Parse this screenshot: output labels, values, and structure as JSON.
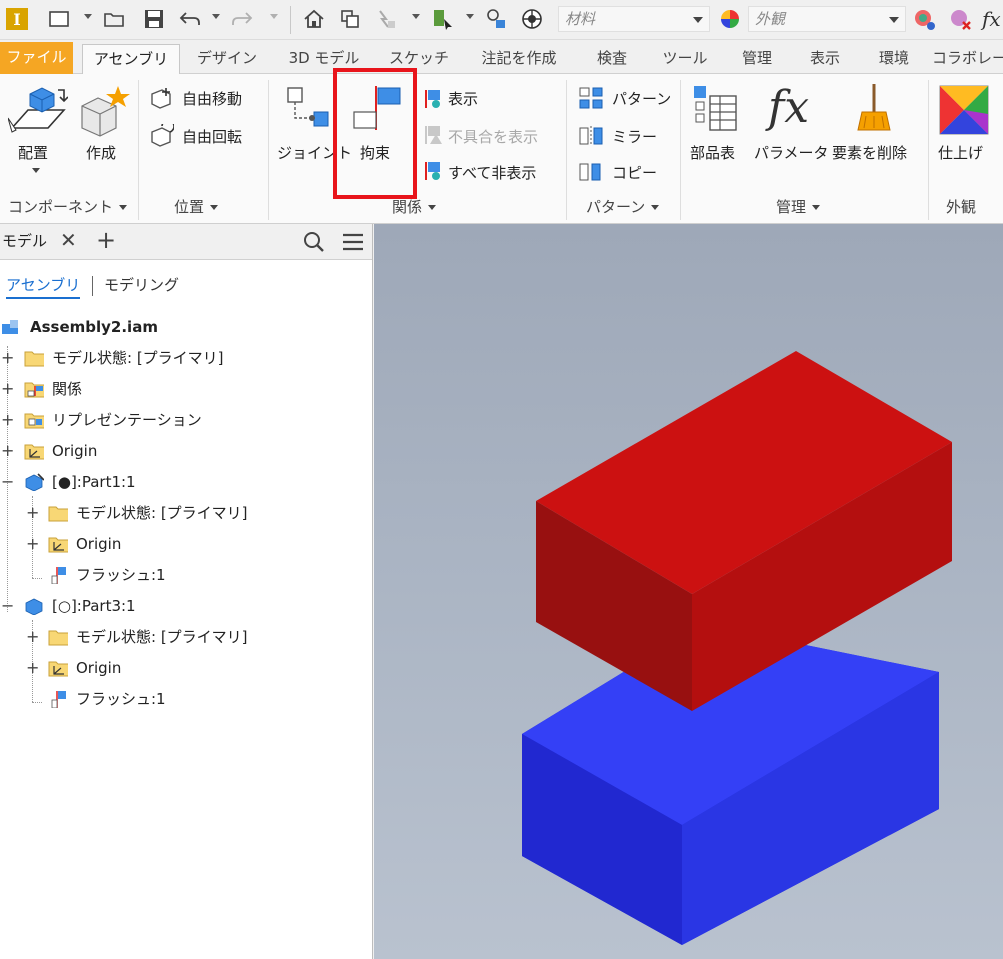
{
  "qat": {
    "material_placeholder": "材料",
    "appearance_placeholder": "外観"
  },
  "tabs": {
    "file": "ファイル",
    "items": [
      "アセンブリ",
      "デザイン",
      "3D モデル",
      "スケッチ",
      "注記を作成",
      "検査",
      "ツール",
      "管理",
      "表示",
      "環境",
      "コラボレー"
    ]
  },
  "ribbon": {
    "component": {
      "place": "配置",
      "create": "作成",
      "group": "コンポーネント"
    },
    "position": {
      "free_move": "自由移動",
      "free_rotate": "自由回転",
      "group": "位置"
    },
    "relationships": {
      "joint": "ジョイント",
      "constrain": "拘束",
      "show": "表示",
      "show_sick": "不具合を表示",
      "hide_all": "すべて非表示",
      "group": "関係"
    },
    "pattern": {
      "pattern": "パターン",
      "mirror": "ミラー",
      "copy": "コピー",
      "group": "パターン"
    },
    "manage": {
      "bom": "部品表",
      "parameters": "パラメータ",
      "delete_face": "要素を削除",
      "group": "管理"
    },
    "appearance": {
      "finish": "仕上げ",
      "group": "外観"
    }
  },
  "panel": {
    "title": "モデル",
    "view_assembly": "アセンブリ",
    "view_modeling": "モデリング",
    "tree": [
      {
        "label": "Assembly2.iam"
      },
      {
        "label": "モデル状態: [プライマリ]"
      },
      {
        "label": "関係"
      },
      {
        "label": "リプレゼンテーション"
      },
      {
        "label": "Origin"
      },
      {
        "label": "[●]:Part1:1"
      },
      {
        "label": "モデル状態: [プライマリ]"
      },
      {
        "label": "Origin"
      },
      {
        "label": "フラッシュ:1"
      },
      {
        "label": "[○]:Part3:1"
      },
      {
        "label": "モデル状態: [プライマリ]"
      },
      {
        "label": "Origin"
      },
      {
        "label": "フラッシュ:1"
      }
    ]
  },
  "colors": {
    "highlight_box": "#e8141b",
    "red_box": "#c8100f",
    "blue_box": "#2b3cf0",
    "file_tab": "#f5a623"
  }
}
